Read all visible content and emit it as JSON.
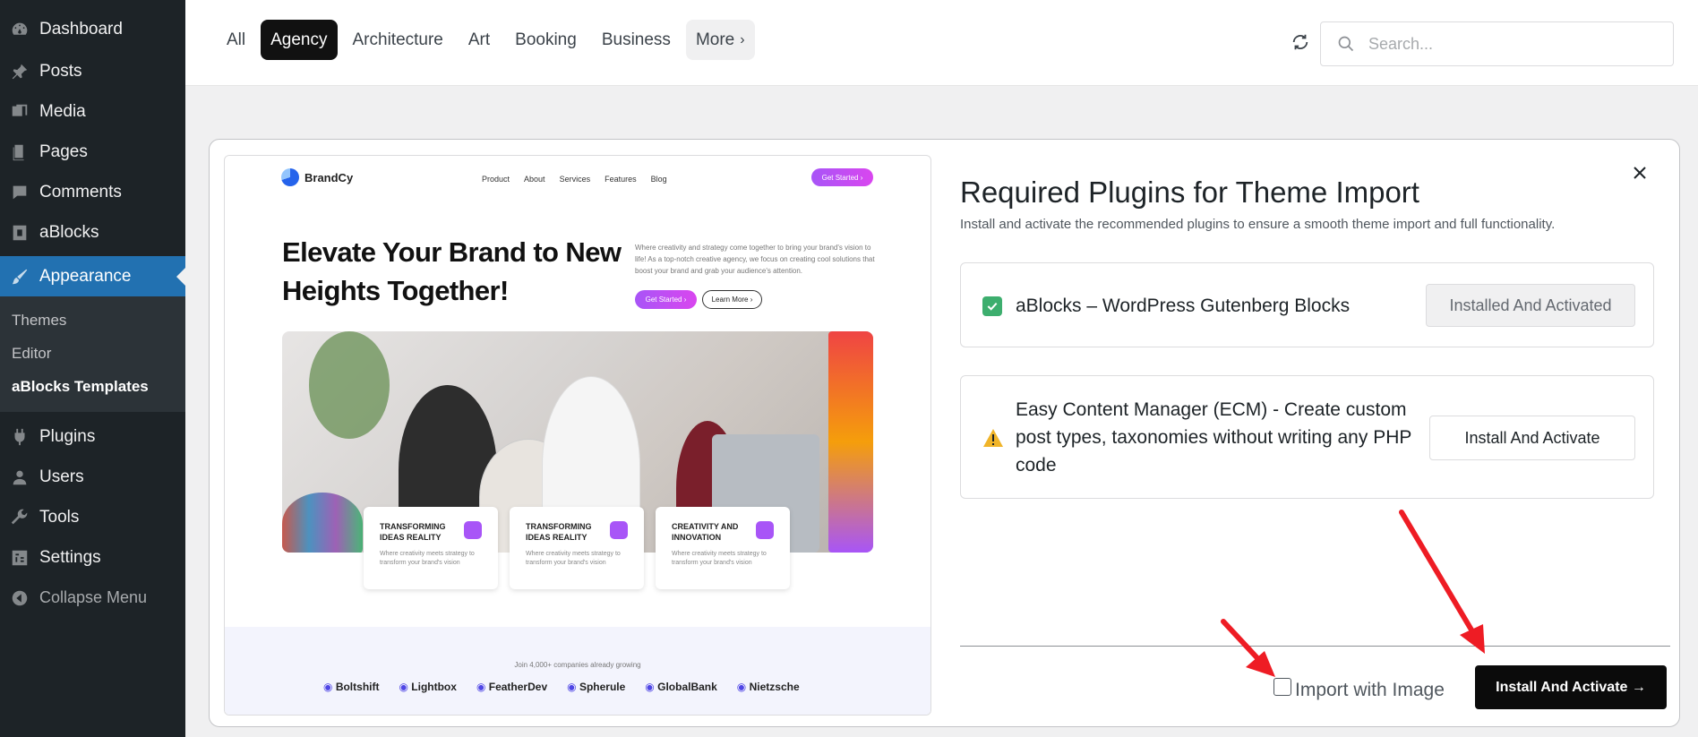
{
  "sidebar": {
    "items": [
      {
        "label": "Dashboard",
        "icon": "dashboard-icon"
      },
      {
        "label": "Posts",
        "icon": "pin-icon"
      },
      {
        "label": "Media",
        "icon": "media-icon"
      },
      {
        "label": "Pages",
        "icon": "pages-icon"
      },
      {
        "label": "Comments",
        "icon": "comment-icon"
      },
      {
        "label": "aBlocks",
        "icon": "ablocks-icon"
      },
      {
        "label": "Appearance",
        "icon": "brush-icon"
      }
    ],
    "submenu": [
      "Themes",
      "Editor",
      "aBlocks Templates"
    ],
    "items2": [
      {
        "label": "Plugins",
        "icon": "plugin-icon"
      },
      {
        "label": "Users",
        "icon": "user-icon"
      },
      {
        "label": "Tools",
        "icon": "wrench-icon"
      },
      {
        "label": "Settings",
        "icon": "settings-icon"
      }
    ],
    "collapse": "Collapse Menu"
  },
  "filters": {
    "categories": [
      "All",
      "Agency",
      "Architecture",
      "Art",
      "Booking",
      "Business"
    ],
    "active": "Agency",
    "more": "More"
  },
  "search": {
    "placeholder": "Search..."
  },
  "preview": {
    "brand": "BrandCy",
    "nav_links": [
      "Product",
      "About",
      "Services",
      "Features",
      "Blog"
    ],
    "cta": "Get Started",
    "headline": "Elevate Your Brand to New Heights Together!",
    "description": "Where creativity and strategy come together to bring your brand's vision to life! As a top-notch creative agency, we focus on creating cool solutions that boost your brand and grab your audience's attention.",
    "btn_primary": "Get Started",
    "btn_secondary": "Learn More",
    "cards": [
      {
        "title": "TRANSFORMING IDEAS REALITY",
        "desc": "Where creativity meets strategy to transform your brand's vision"
      },
      {
        "title": "TRANSFORMING IDEAS REALITY",
        "desc": "Where creativity meets strategy to transform your brand's vision"
      },
      {
        "title": "CREATIVITY AND INNOVATION",
        "desc": "Where creativity meets strategy to transform your brand's vision"
      }
    ],
    "join_text": "Join 4,000+ companies already growing",
    "logos": [
      "Boltshift",
      "Lightbox",
      "FeatherDev",
      "Spherule",
      "GlobalBank",
      "Nietzsche"
    ]
  },
  "modal": {
    "title": "Required Plugins for Theme Import",
    "subtitle": "Install and activate the recommended plugins to ensure a smooth theme import and full functionality.",
    "plugins": [
      {
        "name": "aBlocks – WordPress Gutenberg Blocks",
        "status": "Installed And Activated"
      },
      {
        "name": "Easy Content Manager (ECM) - Create custom post types, taxonomies without writing any PHP code",
        "status": "Install And Activate"
      }
    ],
    "import_label": "Import with Image",
    "primary_button": "Install And Activate →"
  },
  "colors": {
    "sidebar_bg": "#1d2327",
    "active_blue": "#2271b1",
    "check_green": "#3dae6e",
    "arrow_red": "#ee1c24"
  }
}
